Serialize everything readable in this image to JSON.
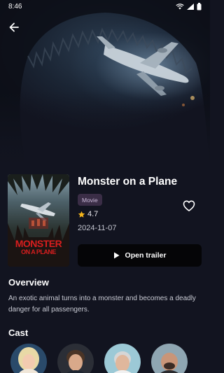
{
  "status_bar": {
    "time": "8:46",
    "icons": [
      "wifi-icon",
      "signal-icon",
      "battery-icon"
    ]
  },
  "navigation": {
    "back_icon": "arrow-left-icon"
  },
  "movie": {
    "title": "Monster on a Plane",
    "type_badge": "Movie",
    "rating": "4.7",
    "rating_icon": "star-icon",
    "release_date": "2024-11-07",
    "favorite_icon": "heart-outline-icon",
    "poster_title_line1": "MONSTER",
    "poster_title_line2": "ON A PLANE"
  },
  "trailer": {
    "label": "Open trailer",
    "icon": "play-icon"
  },
  "overview": {
    "heading": "Overview",
    "text": "An exotic animal turns into a monster and becomes a deadly danger for all passengers."
  },
  "cast": {
    "heading": "Cast",
    "members": [
      {
        "avatar": "cast-avatar-1"
      },
      {
        "avatar": "cast-avatar-2"
      },
      {
        "avatar": "cast-avatar-3"
      },
      {
        "avatar": "cast-avatar-4"
      }
    ]
  },
  "colors": {
    "background": "#121420",
    "button_bg": "#050507",
    "badge_bg": "#3a2d46",
    "badge_text": "#c9b8d8",
    "star": "#f5b51b",
    "poster_title": "#d71e1e"
  }
}
